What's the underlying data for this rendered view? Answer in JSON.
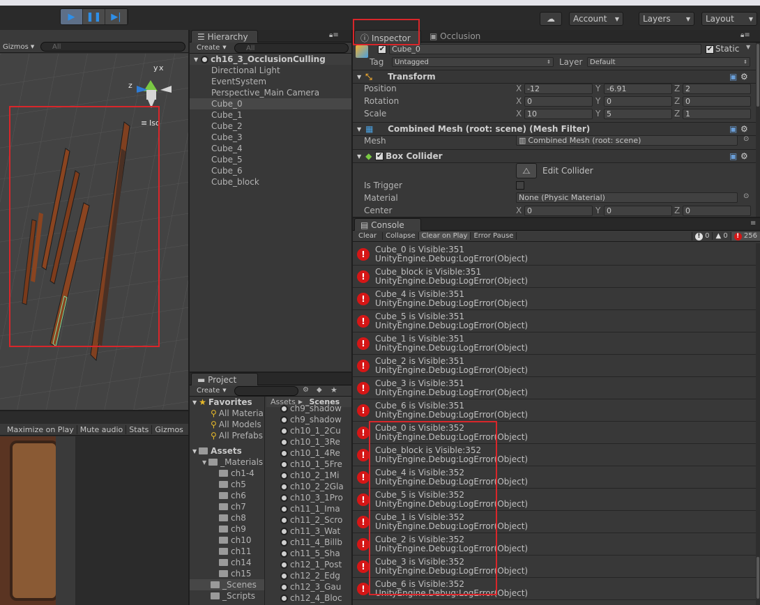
{
  "toolbar": {
    "play_icon": "play-icon",
    "pause_icon": "pause-icon",
    "step_icon": "step-icon",
    "account_label": "Account",
    "layers_label": "Layers",
    "layout_label": "Layout"
  },
  "scene": {
    "gizmos_label": "Gizmos",
    "search_placeholder": "All",
    "iso_label": "Iso",
    "gizmo_y": "y",
    "gizmo_x": "x",
    "gizmo_z": "z"
  },
  "game": {
    "maximize_label": "Maximize on Play",
    "mute_label": "Mute audio",
    "stats_label": "Stats",
    "gizmos_label": "Gizmos"
  },
  "hierarchy": {
    "tab_label": "Hierarchy",
    "create_label": "Create",
    "search_placeholder": "All",
    "scene_name": "ch16_3_OcclusionCulling",
    "items": [
      "Directional Light",
      "EventSystem",
      "Perspective_Main Camera",
      "Cube_0",
      "Cube_1",
      "Cube_2",
      "Cube_3",
      "Cube_4",
      "Cube_5",
      "Cube_6",
      "Cube_block"
    ],
    "selected_index": 3
  },
  "project": {
    "tab_label": "Project",
    "create_label": "Create",
    "favorites_label": "Favorites",
    "favorites": [
      "All Material",
      "All Models",
      "All Prefabs"
    ],
    "assets_label": "Assets",
    "materials_label": "_Materials",
    "folders": [
      "ch1-4",
      "ch5",
      "ch6",
      "ch7",
      "ch8",
      "ch9",
      "ch10",
      "ch11",
      "ch14",
      "ch15"
    ],
    "scenes_label": "_Scenes",
    "scripts_label": "_Scripts",
    "breadcrumb_root": "Assets",
    "breadcrumb_current": "_Scenes",
    "scene_files": [
      "ch9_shadow",
      "ch9_shadow",
      "ch10_1_2Cu",
      "ch10_1_3Re",
      "ch10_1_4Re",
      "ch10_1_5Fre",
      "ch10_2_1Mi",
      "ch10_2_2Gla",
      "ch10_3_1Pro",
      "ch11_1_Ima",
      "ch11_2_Scro",
      "ch11_3_Wat",
      "ch11_4_Billb",
      "ch11_5_Sha",
      "ch12_1_Post",
      "ch12_2_Edg",
      "ch12_3_Gau",
      "ch12_4_Bloc"
    ]
  },
  "inspector": {
    "tab_label": "Inspector",
    "occlusion_tab_label": "Occlusion",
    "object_name": "Cube_0",
    "static_label": "Static",
    "tag_label": "Tag",
    "tag_value": "Untagged",
    "layer_label": "Layer",
    "layer_value": "Default",
    "transform": {
      "title": "Transform",
      "position_label": "Position",
      "rotation_label": "Rotation",
      "scale_label": "Scale",
      "position": {
        "x": "-12",
        "y": "-6.91",
        "z": "2"
      },
      "rotation": {
        "x": "0",
        "y": "0",
        "z": "0"
      },
      "scale": {
        "x": "10",
        "y": "5",
        "z": "1"
      }
    },
    "mesh_filter": {
      "title": "Combined Mesh (root: scene) (Mesh Filter)",
      "mesh_label": "Mesh",
      "mesh_value": "Combined Mesh (root: scene)"
    },
    "box_collider": {
      "title": "Box Collider",
      "edit_label": "Edit Collider",
      "is_trigger_label": "Is Trigger",
      "material_label": "Material",
      "material_value": "None (Physic Material)",
      "center_label": "Center",
      "center": {
        "x": "0",
        "y": "0",
        "z": "0"
      }
    },
    "axis_x": "X",
    "axis_y": "Y",
    "axis_z": "Z"
  },
  "console": {
    "tab_label": "Console",
    "clear_label": "Clear",
    "collapse_label": "Collapse",
    "clear_on_play_label": "Clear on Play",
    "error_pause_label": "Error Pause",
    "info_count": "0",
    "warn_count": "0",
    "error_count": "256",
    "logs": [
      {
        "msg": "Cube_0 is Visible:351",
        "trace": "UnityEngine.Debug:LogError(Object)"
      },
      {
        "msg": "Cube_block is Visible:351",
        "trace": "UnityEngine.Debug:LogError(Object)"
      },
      {
        "msg": "Cube_4 is Visible:351",
        "trace": "UnityEngine.Debug:LogError(Object)"
      },
      {
        "msg": "Cube_5 is Visible:351",
        "trace": "UnityEngine.Debug:LogError(Object)"
      },
      {
        "msg": "Cube_1 is Visible:351",
        "trace": "UnityEngine.Debug:LogError(Object)"
      },
      {
        "msg": "Cube_2 is Visible:351",
        "trace": "UnityEngine.Debug:LogError(Object)"
      },
      {
        "msg": "Cube_3 is Visible:351",
        "trace": "UnityEngine.Debug:LogError(Object)"
      },
      {
        "msg": "Cube_6 is Visible:351",
        "trace": "UnityEngine.Debug:LogError(Object)"
      },
      {
        "msg": "Cube_0 is Visible:352",
        "trace": "UnityEngine.Debug:LogError(Object)"
      },
      {
        "msg": "Cube_block is Visible:352",
        "trace": "UnityEngine.Debug:LogError(Object)"
      },
      {
        "msg": "Cube_4 is Visible:352",
        "trace": "UnityEngine.Debug:LogError(Object)"
      },
      {
        "msg": "Cube_5 is Visible:352",
        "trace": "UnityEngine.Debug:LogError(Object)"
      },
      {
        "msg": "Cube_1 is Visible:352",
        "trace": "UnityEngine.Debug:LogError(Object)"
      },
      {
        "msg": "Cube_2 is Visible:352",
        "trace": "UnityEngine.Debug:LogError(Object)"
      },
      {
        "msg": "Cube_3 is Visible:352",
        "trace": "UnityEngine.Debug:LogError(Object)"
      },
      {
        "msg": "Cube_6 is Visible:352",
        "trace": "UnityEngine.Debug:LogError(Object)"
      }
    ]
  },
  "colors": {
    "highlight": "#d9262a",
    "error": "#d51616",
    "accent": "#2e8fe8"
  }
}
